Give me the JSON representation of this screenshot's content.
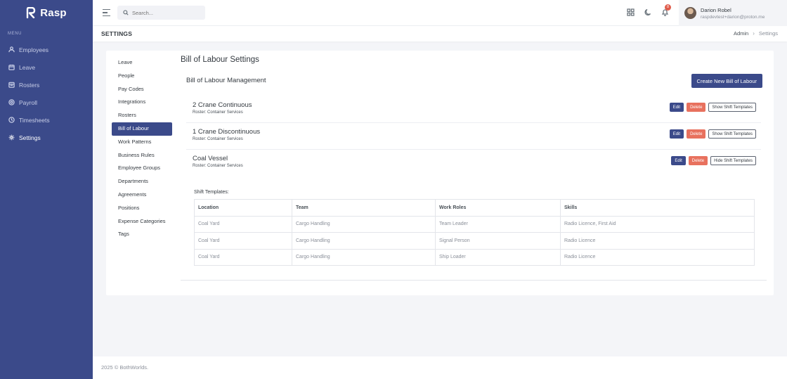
{
  "app": {
    "name": "Rasp"
  },
  "sidebar": {
    "menu_title": "MENU",
    "items": [
      {
        "label": "Employees",
        "icon": "users-icon"
      },
      {
        "label": "Leave",
        "icon": "calendar-icon"
      },
      {
        "label": "Rosters",
        "icon": "roster-icon"
      },
      {
        "label": "Payroll",
        "icon": "payroll-icon"
      },
      {
        "label": "Timesheets",
        "icon": "clock-icon"
      },
      {
        "label": "Settings",
        "icon": "gear-icon"
      }
    ],
    "active": "Settings"
  },
  "topbar": {
    "search_placeholder": "Search...",
    "notification_count": "8",
    "user": {
      "name": "Darion Robel",
      "email": "raspdevtest+darion@proton.me"
    }
  },
  "header": {
    "title": "SETTINGS",
    "breadcrumb": [
      "Admin",
      "Settings"
    ]
  },
  "settings_nav": {
    "items": [
      "Leave",
      "People",
      "Pay Codes",
      "Integrations",
      "Rosters",
      "Bill of Labour",
      "Work Patterns",
      "Business Rules",
      "Employee Groups",
      "Departments",
      "Agreements",
      "Positions",
      "Expense Categories",
      "Tags"
    ],
    "active": "Bill of Labour"
  },
  "main": {
    "title": "Bill of Labour Settings",
    "panel_title": "Bill of Labour Management",
    "create_label": "Create New Bill of Labour",
    "rows": [
      {
        "name": "2 Crane Continuous",
        "roster": "Roster: Container Services",
        "edit": "Edit",
        "delete": "Delete",
        "toggle": "Show Shift Templates"
      },
      {
        "name": "1 Crane Discontinuous",
        "roster": "Roster: Container Services",
        "edit": "Edit",
        "delete": "Delete",
        "toggle": "Show Shift Templates"
      },
      {
        "name": "Coal Vessel",
        "roster": "Roster: Container Services",
        "edit": "Edit",
        "delete": "Delete",
        "toggle": "Hide Shift Templates"
      }
    ],
    "shift_templates": {
      "label": "Shift Templates:",
      "columns": [
        "Location",
        "Team",
        "Work Roles",
        "Skills"
      ],
      "rows": [
        [
          "Coal Yard",
          "Cargo Handling",
          "Team Leader",
          "Radio Licence, First Aid"
        ],
        [
          "Coal Yard",
          "Cargo Handling",
          "Signal Person",
          "Radio Licence"
        ],
        [
          "Coal Yard",
          "Cargo Handling",
          "Ship Loader",
          "Radio Licence"
        ]
      ]
    }
  },
  "footer": {
    "text": "2025 © BothWorlds."
  },
  "colors": {
    "brand": "#3b4a8a",
    "danger": "#e8715e",
    "badge": "#e05c4b"
  }
}
